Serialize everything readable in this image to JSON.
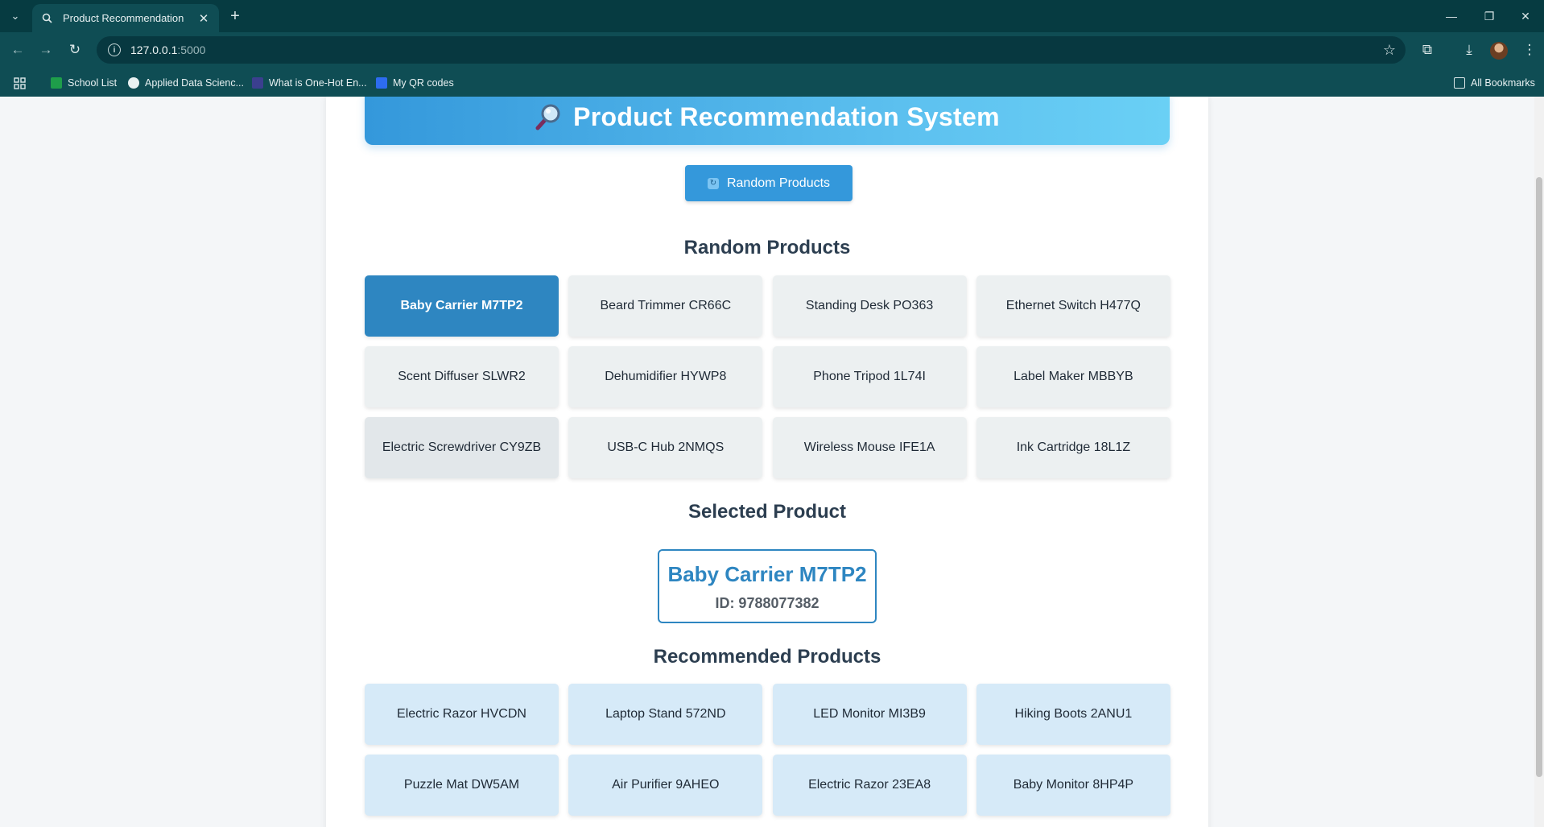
{
  "browser": {
    "tab_title": "Product Recommendation",
    "url_host": "127.0.0.1",
    "url_port": ":5000",
    "bookmarks": [
      {
        "label": "School List",
        "color": "#1e9e4a"
      },
      {
        "label": "Applied Data Scienc...",
        "color": "#e8f1f2"
      },
      {
        "label": "What is One-Hot En...",
        "color": "#3b3f8f"
      },
      {
        "label": "My QR codes",
        "color": "#2d6cf0"
      }
    ],
    "all_bookmarks": "All Bookmarks"
  },
  "page": {
    "title": "Product Recommendation System",
    "random_button_label": "Random Products",
    "random_heading": "Random Products",
    "selected_heading": "Selected Product",
    "recommended_heading": "Recommended Products"
  },
  "random_products": [
    "Baby Carrier M7TP2",
    "Beard Trimmer CR66C",
    "Standing Desk PO363",
    "Ethernet Switch H477Q",
    "Scent Diffuser SLWR2",
    "Dehumidifier HYWP8",
    "Phone Tripod 1L74I",
    "Label Maker MBBYB",
    "Electric Screwdriver CY9ZB",
    "USB-C Hub 2NMQS",
    "Wireless Mouse IFE1A",
    "Ink Cartridge 18L1Z"
  ],
  "selected_product": {
    "name": "Baby Carrier M7TP2",
    "id_text": "ID: 9788077382"
  },
  "recommended_products": [
    "Electric Razor HVCDN",
    "Laptop Stand 572ND",
    "LED Monitor MI3B9",
    "Hiking Boots 2ANU1",
    "Puzzle Mat DW5AM",
    "Air Purifier 9AHEO",
    "Electric Razor 23EA8",
    "Baby Monitor 8HP4P"
  ],
  "colors": {
    "accent": "#3498db",
    "active_card": "#2e86c1",
    "recommended_card": "#d6eaf8",
    "random_card": "#ecf0f1"
  }
}
